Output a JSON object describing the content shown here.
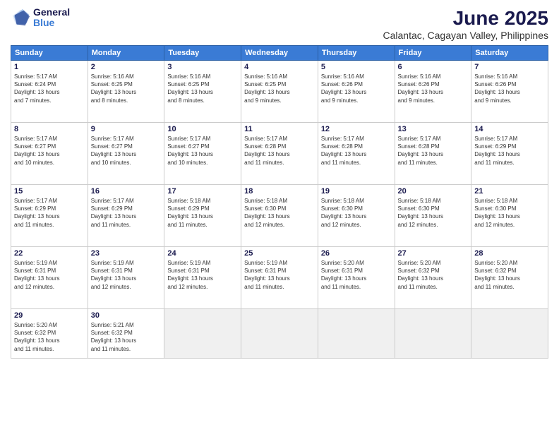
{
  "header": {
    "logo_line1": "General",
    "logo_line2": "Blue",
    "main_title": "June 2025",
    "subtitle": "Calantac, Cagayan Valley, Philippines"
  },
  "weekdays": [
    "Sunday",
    "Monday",
    "Tuesday",
    "Wednesday",
    "Thursday",
    "Friday",
    "Saturday"
  ],
  "weeks": [
    [
      {
        "day": "1",
        "info": "Sunrise: 5:17 AM\nSunset: 6:24 PM\nDaylight: 13 hours\nand 7 minutes."
      },
      {
        "day": "2",
        "info": "Sunrise: 5:16 AM\nSunset: 6:25 PM\nDaylight: 13 hours\nand 8 minutes."
      },
      {
        "day": "3",
        "info": "Sunrise: 5:16 AM\nSunset: 6:25 PM\nDaylight: 13 hours\nand 8 minutes."
      },
      {
        "day": "4",
        "info": "Sunrise: 5:16 AM\nSunset: 6:25 PM\nDaylight: 13 hours\nand 9 minutes."
      },
      {
        "day": "5",
        "info": "Sunrise: 5:16 AM\nSunset: 6:26 PM\nDaylight: 13 hours\nand 9 minutes."
      },
      {
        "day": "6",
        "info": "Sunrise: 5:16 AM\nSunset: 6:26 PM\nDaylight: 13 hours\nand 9 minutes."
      },
      {
        "day": "7",
        "info": "Sunrise: 5:16 AM\nSunset: 6:26 PM\nDaylight: 13 hours\nand 9 minutes."
      }
    ],
    [
      {
        "day": "8",
        "info": "Sunrise: 5:17 AM\nSunset: 6:27 PM\nDaylight: 13 hours\nand 10 minutes."
      },
      {
        "day": "9",
        "info": "Sunrise: 5:17 AM\nSunset: 6:27 PM\nDaylight: 13 hours\nand 10 minutes."
      },
      {
        "day": "10",
        "info": "Sunrise: 5:17 AM\nSunset: 6:27 PM\nDaylight: 13 hours\nand 10 minutes."
      },
      {
        "day": "11",
        "info": "Sunrise: 5:17 AM\nSunset: 6:28 PM\nDaylight: 13 hours\nand 11 minutes."
      },
      {
        "day": "12",
        "info": "Sunrise: 5:17 AM\nSunset: 6:28 PM\nDaylight: 13 hours\nand 11 minutes."
      },
      {
        "day": "13",
        "info": "Sunrise: 5:17 AM\nSunset: 6:28 PM\nDaylight: 13 hours\nand 11 minutes."
      },
      {
        "day": "14",
        "info": "Sunrise: 5:17 AM\nSunset: 6:29 PM\nDaylight: 13 hours\nand 11 minutes."
      }
    ],
    [
      {
        "day": "15",
        "info": "Sunrise: 5:17 AM\nSunset: 6:29 PM\nDaylight: 13 hours\nand 11 minutes."
      },
      {
        "day": "16",
        "info": "Sunrise: 5:17 AM\nSunset: 6:29 PM\nDaylight: 13 hours\nand 11 minutes."
      },
      {
        "day": "17",
        "info": "Sunrise: 5:18 AM\nSunset: 6:29 PM\nDaylight: 13 hours\nand 11 minutes."
      },
      {
        "day": "18",
        "info": "Sunrise: 5:18 AM\nSunset: 6:30 PM\nDaylight: 13 hours\nand 12 minutes."
      },
      {
        "day": "19",
        "info": "Sunrise: 5:18 AM\nSunset: 6:30 PM\nDaylight: 13 hours\nand 12 minutes."
      },
      {
        "day": "20",
        "info": "Sunrise: 5:18 AM\nSunset: 6:30 PM\nDaylight: 13 hours\nand 12 minutes."
      },
      {
        "day": "21",
        "info": "Sunrise: 5:18 AM\nSunset: 6:30 PM\nDaylight: 13 hours\nand 12 minutes."
      }
    ],
    [
      {
        "day": "22",
        "info": "Sunrise: 5:19 AM\nSunset: 6:31 PM\nDaylight: 13 hours\nand 12 minutes."
      },
      {
        "day": "23",
        "info": "Sunrise: 5:19 AM\nSunset: 6:31 PM\nDaylight: 13 hours\nand 12 minutes."
      },
      {
        "day": "24",
        "info": "Sunrise: 5:19 AM\nSunset: 6:31 PM\nDaylight: 13 hours\nand 12 minutes."
      },
      {
        "day": "25",
        "info": "Sunrise: 5:19 AM\nSunset: 6:31 PM\nDaylight: 13 hours\nand 11 minutes."
      },
      {
        "day": "26",
        "info": "Sunrise: 5:20 AM\nSunset: 6:31 PM\nDaylight: 13 hours\nand 11 minutes."
      },
      {
        "day": "27",
        "info": "Sunrise: 5:20 AM\nSunset: 6:32 PM\nDaylight: 13 hours\nand 11 minutes."
      },
      {
        "day": "28",
        "info": "Sunrise: 5:20 AM\nSunset: 6:32 PM\nDaylight: 13 hours\nand 11 minutes."
      }
    ],
    [
      {
        "day": "29",
        "info": "Sunrise: 5:20 AM\nSunset: 6:32 PM\nDaylight: 13 hours\nand 11 minutes."
      },
      {
        "day": "30",
        "info": "Sunrise: 5:21 AM\nSunset: 6:32 PM\nDaylight: 13 hours\nand 11 minutes."
      },
      {
        "day": "",
        "info": ""
      },
      {
        "day": "",
        "info": ""
      },
      {
        "day": "",
        "info": ""
      },
      {
        "day": "",
        "info": ""
      },
      {
        "day": "",
        "info": ""
      }
    ]
  ]
}
